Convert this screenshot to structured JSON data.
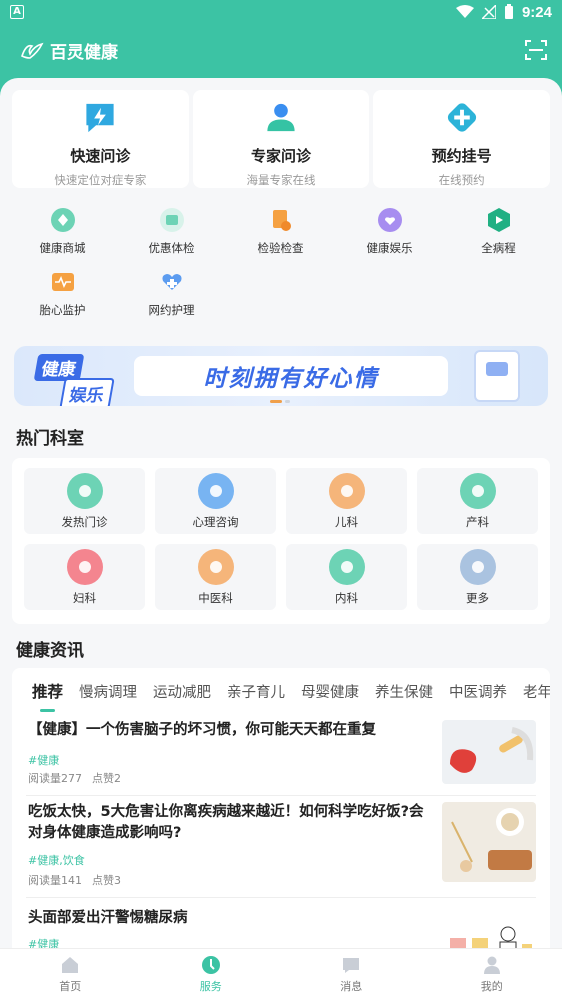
{
  "statusbar": {
    "indicator": "A",
    "time": "9:24"
  },
  "app": {
    "title": "百灵健康"
  },
  "top_cards": [
    {
      "title": "快速问诊",
      "subtitle": "快速定位对症专家"
    },
    {
      "title": "专家问诊",
      "subtitle": "海量专家在线"
    },
    {
      "title": "预约挂号",
      "subtitle": "在线预约"
    }
  ],
  "grid": [
    {
      "label": "健康商城"
    },
    {
      "label": "优惠体检"
    },
    {
      "label": "检验检查"
    },
    {
      "label": "健康娱乐"
    },
    {
      "label": "全病程"
    },
    {
      "label": "胎心监护"
    },
    {
      "label": "网约护理"
    }
  ],
  "banner": {
    "tag1": "健康",
    "tag2": "娱乐",
    "slogan": "时刻拥有好心情"
  },
  "departments": {
    "title": "热门科室",
    "items": [
      {
        "label": "发热门诊",
        "color": "#6dd3b5"
      },
      {
        "label": "心理咨询",
        "color": "#78b4f2"
      },
      {
        "label": "儿科",
        "color": "#f5b57a"
      },
      {
        "label": "产科",
        "color": "#6dd3b5"
      },
      {
        "label": "妇科",
        "color": "#f4858f"
      },
      {
        "label": "中医科",
        "color": "#f5b57a"
      },
      {
        "label": "内科",
        "color": "#6dd3b5"
      },
      {
        "label": "更多",
        "color": "#aac3e0"
      }
    ]
  },
  "news": {
    "title": "健康资讯",
    "tabs": [
      "推荐",
      "慢病调理",
      "运动减肥",
      "亲子育儿",
      "母婴健康",
      "养生保健",
      "中医调养",
      "老年"
    ],
    "articles": [
      {
        "title": "【健康】一个伤害脑子的坏习惯，你可能天天都在重复",
        "tag": "#健康",
        "reads": "阅读量277",
        "likes": "点赞2"
      },
      {
        "title": "吃饭太快，5大危害让你离疾病越来越近！如何科学吃好饭?会对身体健康造成影响吗?",
        "tag": "#健康,饮食",
        "reads": "阅读量141",
        "likes": "点赞3"
      },
      {
        "title": "头面部爱出汗警惕糖尿病",
        "tag": "#健康"
      }
    ]
  },
  "bottom_nav": [
    {
      "label": "首页"
    },
    {
      "label": "服务"
    },
    {
      "label": "消息"
    },
    {
      "label": "我的"
    }
  ],
  "colors": {
    "brand": "#3cc3a4",
    "accent_blue": "#3a6be6"
  }
}
